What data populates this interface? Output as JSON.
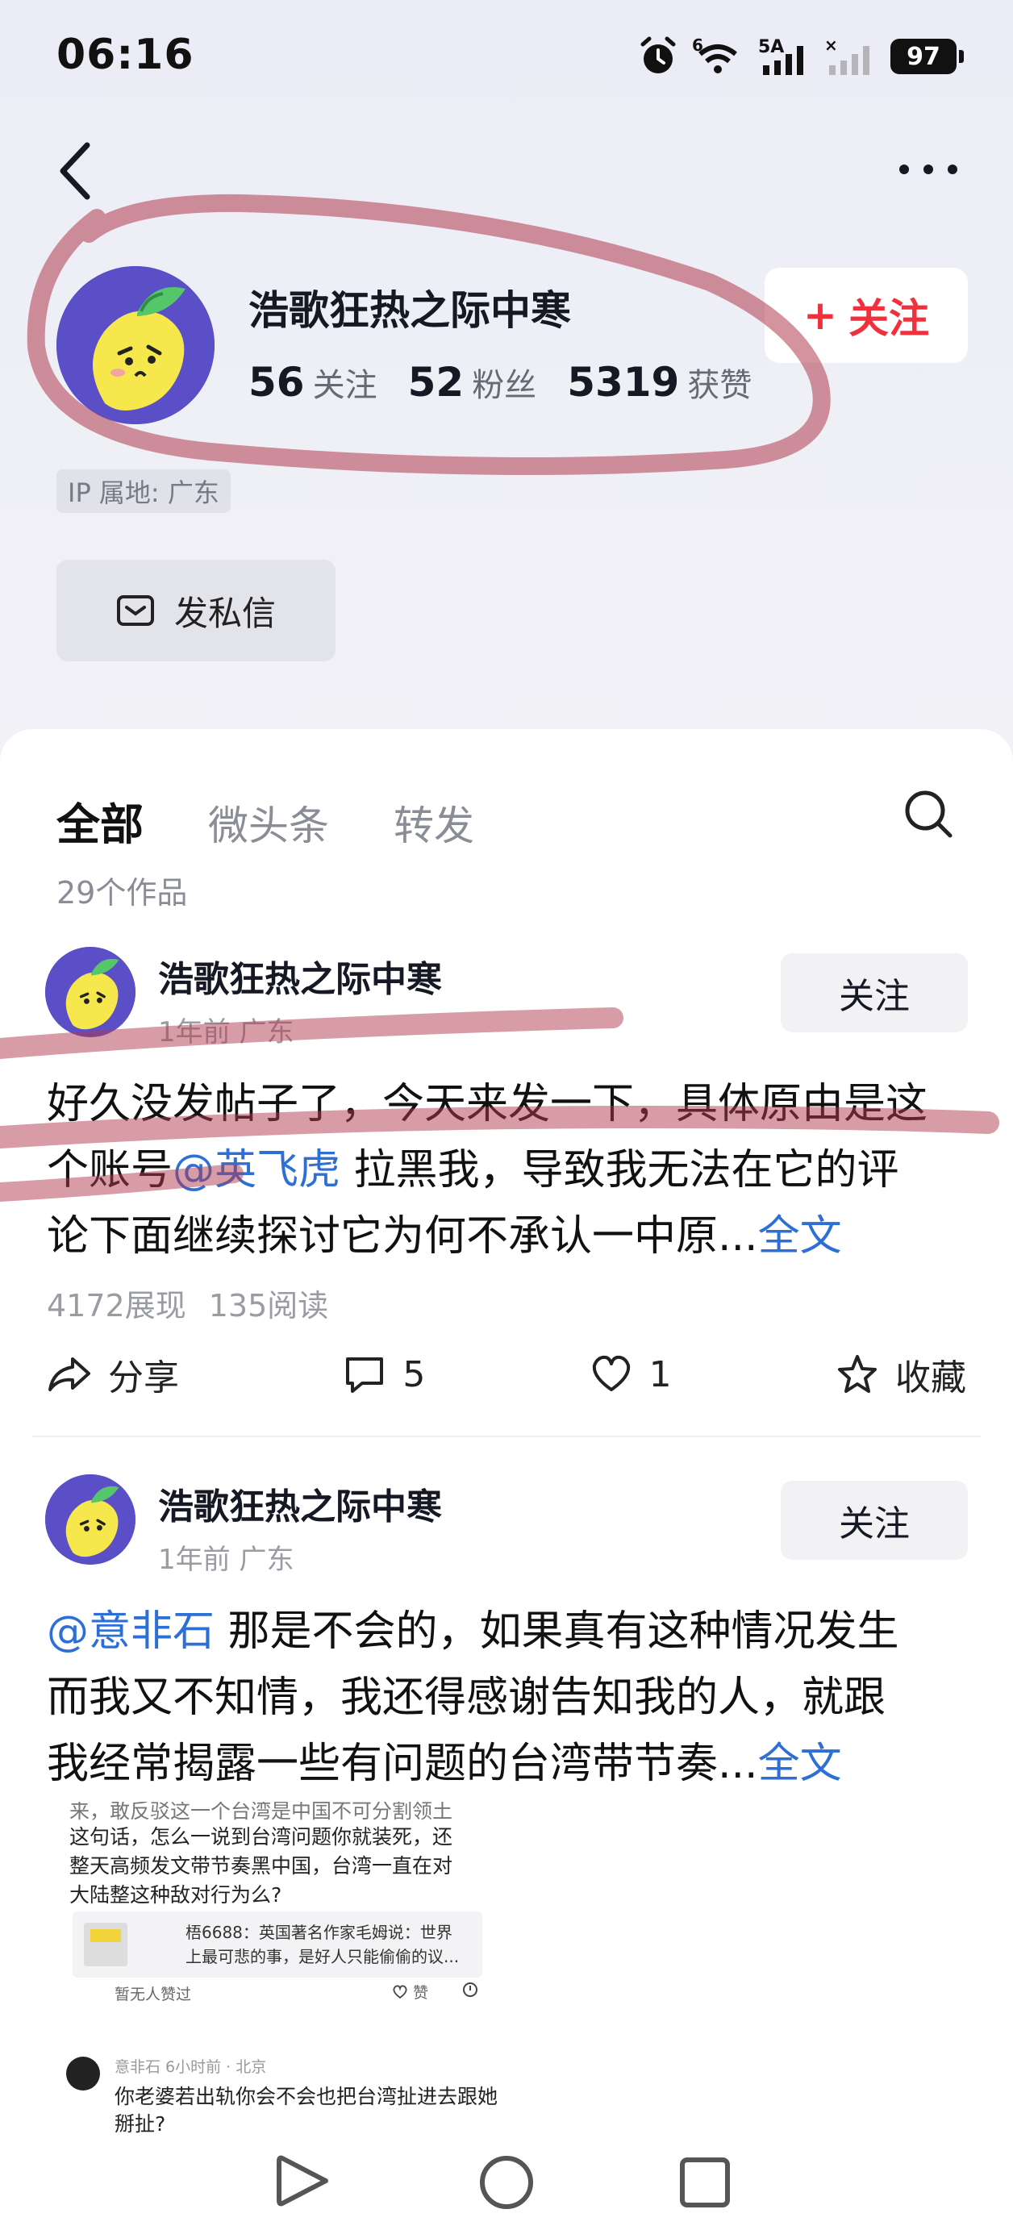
{
  "status_bar": {
    "time": "06:16",
    "battery": "97",
    "network_5a": "5A",
    "network_6": "6",
    "icons": [
      "alarm-icon",
      "wifi-icon",
      "signal-icon",
      "signal-x-icon",
      "battery-icon"
    ]
  },
  "nav": {
    "back_icon": "chevron-left-icon",
    "more_icon": "more-horizontal-icon"
  },
  "profile": {
    "name": "浩歌狂热之际中寒",
    "stats": [
      {
        "num": "56",
        "label": "关注"
      },
      {
        "num": "52",
        "label": "粉丝"
      },
      {
        "num": "5319",
        "label": "获赞"
      }
    ],
    "follow_label": "关注",
    "follow_plus": "+",
    "ip": "IP 属地: 广东",
    "dm_label": "发私信"
  },
  "tabs": {
    "items": [
      "全部",
      "微头条",
      "转发"
    ],
    "active": "全部",
    "works_count": "29个作品"
  },
  "posts": [
    {
      "author": "浩歌狂热之际中寒",
      "meta": "1年前 广东",
      "follow": "关注",
      "line1": "好久没发帖子了，今天来发一下，具体原由是这",
      "line2_pre": "个账号",
      "mention": "@英飞虎",
      "line2_post": " 拉黑我，导致我无法在它的评",
      "line3": "论下面继续探讨它为何不承认一中原...",
      "full_text": "全文",
      "views": "4172展现",
      "reads": "135阅读",
      "share": "分享",
      "comments": "5",
      "likes": "1",
      "collect": "收藏"
    },
    {
      "author": "浩歌狂热之际中寒",
      "meta": "1年前 广东",
      "follow": "关注",
      "mention": "@意非石",
      "line1_post": " 那是不会的，如果真有这种情况发生",
      "line2": "而我又不知情，我还得感谢告知我的人，就跟",
      "line3": "我经常揭露一些有问题的台湾带节奏...",
      "full_text": "全文"
    }
  ],
  "embedded": {
    "line0": "来，敢反驳这一个台湾是中国不可分割领土",
    "line1": "这句话，怎么一说到台湾问题你就装死，还",
    "line2": "整天高频发文带节奏黑中国，台湾一直在对",
    "line3": "大陆整这种敌对行为么?",
    "quote_line1": "梧6688：英国著名作家毛姆说：世界",
    "quote_line2": "上最可悲的事，是好人只能偷偷的议...",
    "no_likes": "暂无人赞过",
    "like": "赞",
    "commenter_meta": "意非石  6小时前 · 北京",
    "reply_line1": "你老婆若出轨你会不会也把台湾扯进去跟她",
    "reply_line2": "掰扯?"
  },
  "colors": {
    "accent_red": "#f0303d",
    "link_blue": "#2e6fd6",
    "avatar_purple": "#5b4fc7",
    "scribble": "#b03a4c"
  }
}
